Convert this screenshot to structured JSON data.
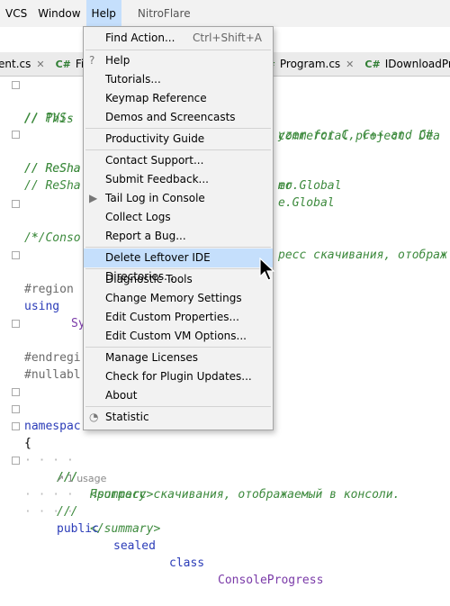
{
  "menubar": {
    "items": [
      {
        "label": "VCS"
      },
      {
        "label": "Window"
      },
      {
        "label": "Help"
      },
      {
        "label": "NitroFlare"
      }
    ]
  },
  "tabs": [
    {
      "label": "ent.cs"
    },
    {
      "label": "Fil"
    },
    {
      "label": "Program.cs"
    },
    {
      "label": "IDownloadPr"
    }
  ],
  "cs_badge": "C#",
  "editor": {
    "l1": "// This",
    "l1b": "commercial project. Dea",
    "l2": "// PVS-",
    "l2b": "yzer for C, C++ and C#",
    "l3": "// ReSha",
    "l3b": "mo",
    "l4": "// ReSha",
    "l4b": "er.Global",
    "l5": "// ReSha",
    "l5b": "e.Global",
    "l6": "/* Conso",
    "l6b": "ресс скачивания, отображ",
    "l7": " */",
    "l8": "#region",
    "l9a": "using",
    "l9b": "Sy",
    "l10": "#endregi",
    "l11": "#nullabl",
    "l12": "namespac",
    "l13": "{",
    "l14a": "///",
    "l14b": "<summary>",
    "l15a": "///",
    "l15b": "Прогресс скачивания, отображаемый в консоли.",
    "l16a": "///",
    "l16b": "</summary>",
    "usage": "1 usage",
    "l18a": "public",
    "l18b": "sealed",
    "l18c": "class",
    "l18d": "ConsoleProgress"
  },
  "help_menu": {
    "items": [
      {
        "label": "Find Action...",
        "shortcut": "Ctrl+Shift+A"
      },
      {
        "label": "Help",
        "icon": "?"
      },
      {
        "label": "Tutorials..."
      },
      {
        "label": "Keymap Reference"
      },
      {
        "label": "Demos and Screencasts"
      },
      {
        "label": "Productivity Guide"
      },
      {
        "label": "Contact Support..."
      },
      {
        "label": "Submit Feedback..."
      },
      {
        "label": "Tail Log in Console"
      },
      {
        "label": "Collect Logs"
      },
      {
        "label": "Report a Bug..."
      },
      {
        "label": "Delete Leftover IDE Directories..."
      },
      {
        "label": "Diagnostic Tools"
      },
      {
        "label": "Change Memory Settings"
      },
      {
        "label": "Edit Custom Properties..."
      },
      {
        "label": "Edit Custom VM Options..."
      },
      {
        "label": "Manage Licenses"
      },
      {
        "label": "Check for Plugin Updates..."
      },
      {
        "label": "About"
      },
      {
        "label": "Statistic"
      }
    ]
  },
  "colors": {
    "highlight": "#c5dffc",
    "comment": "#3d8a3d",
    "keyword": "#2b3cb8"
  }
}
